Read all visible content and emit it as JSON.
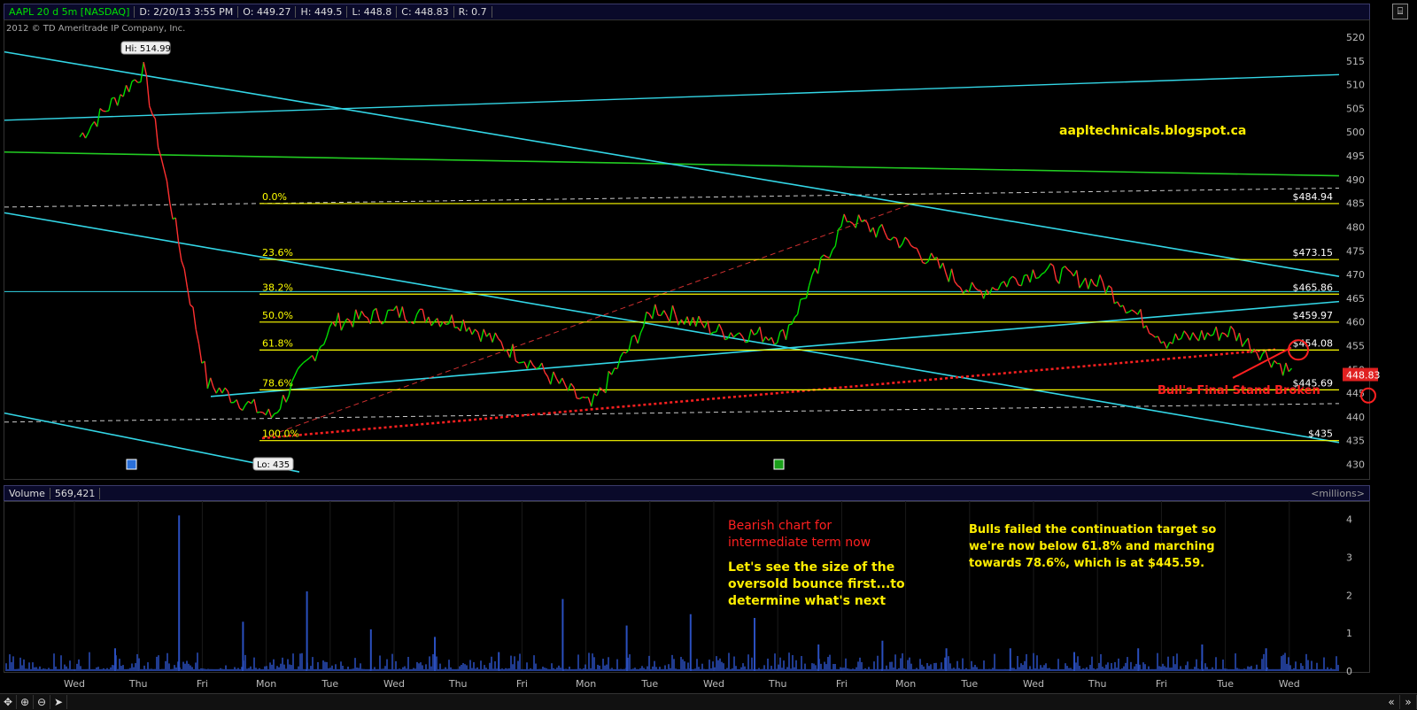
{
  "header": {
    "symbol": "AAPL 20 d 5m [NASDAQ]",
    "date": "D: 2/20/13 3:55 PM",
    "open": "O: 449.27",
    "high": "H: 449.5",
    "low": "L: 448.8",
    "close": "C: 448.83",
    "range": "R: 0.7"
  },
  "copyright": "2012 © TD Ameritrade IP Company, Inc.",
  "price_axis": {
    "labels": [
      "520",
      "515",
      "510",
      "505",
      "500",
      "495",
      "490",
      "485",
      "480",
      "475",
      "470",
      "465",
      "460",
      "455",
      "450",
      "445",
      "440",
      "435",
      "430"
    ]
  },
  "current_price": "448.83",
  "time_axis": {
    "labels": [
      "Wed",
      "Thu",
      "Fri",
      "Mon",
      "Tue",
      "Wed",
      "Thu",
      "Fri",
      "Mon",
      "Tue",
      "Wed",
      "Thu",
      "Fri",
      "Mon",
      "Tue",
      "Wed",
      "Thu",
      "Fri",
      "Tue",
      "Wed"
    ]
  },
  "fib": {
    "left_labels": [
      "0.0%",
      "23.6%",
      "38.2%",
      "50.0%",
      "61.8%",
      "78.6%",
      "100.0%"
    ],
    "right_labels": [
      "$484.94",
      "$473.15",
      "$465.86",
      "$459.97",
      "$454.08",
      "$445.69",
      "$435"
    ],
    "values": [
      484.94,
      473.15,
      465.86,
      459.97,
      454.08,
      445.69,
      435
    ],
    "color": "#ffff00"
  },
  "callouts": {
    "hi": "Hi: 514.99",
    "lo": "Lo: 435"
  },
  "annotations": {
    "blog": "aapltechnicals.blogspot.ca",
    "broken": "Bull's Final Stand Broken",
    "bearish1": "Bearish chart for",
    "bearish2": "intermediate term now",
    "bounce1": "Let's see the size of the",
    "bounce2": "oversold bounce first...to",
    "bounce3": "determine what's next",
    "bulls1": "Bulls failed the continuation target so",
    "bulls2": "we're now below 61.8% and marching",
    "bulls3": "towards 78.6%, which is at $445.59."
  },
  "volume": {
    "label": "Volume",
    "value": "569,421",
    "units": "<millions>",
    "axis_labels": [
      "4",
      "3",
      "2",
      "1",
      "0"
    ]
  },
  "colors": {
    "up": "#00dd00",
    "down": "#ff3030",
    "trend": "#33d6e6",
    "green_line": "#22cc22",
    "volume": "#2a4fbf"
  },
  "chart_data": {
    "type": "line",
    "title": "AAPL 20 d 5m [NASDAQ]",
    "ylim": [
      430,
      522
    ],
    "x": [
      "Wed",
      "Thu",
      "Fri",
      "Mon",
      "Tue",
      "Wed",
      "Thu",
      "Fri",
      "Mon",
      "Tue",
      "Wed",
      "Thu",
      "Fri",
      "Mon",
      "Tue",
      "Wed",
      "Thu",
      "Fri",
      "Tue",
      "Wed"
    ],
    "series": [
      {
        "name": "AAPL",
        "values": [
          499,
          513,
          447,
          440,
          460,
          462,
          460,
          452,
          442,
          463,
          458,
          457,
          482,
          476,
          466,
          471,
          468,
          456,
          458,
          449
        ]
      }
    ],
    "volume_ylim": [
      0,
      4
    ],
    "volume_spikes": [
      0.6,
      4.1,
      1.3,
      2.1,
      1.1,
      0.9,
      0.5,
      1.9,
      1.2,
      1.5,
      1.4,
      0.7,
      0.8,
      0.6,
      0.6,
      0.5,
      0.6,
      0.7,
      0.6
    ]
  }
}
